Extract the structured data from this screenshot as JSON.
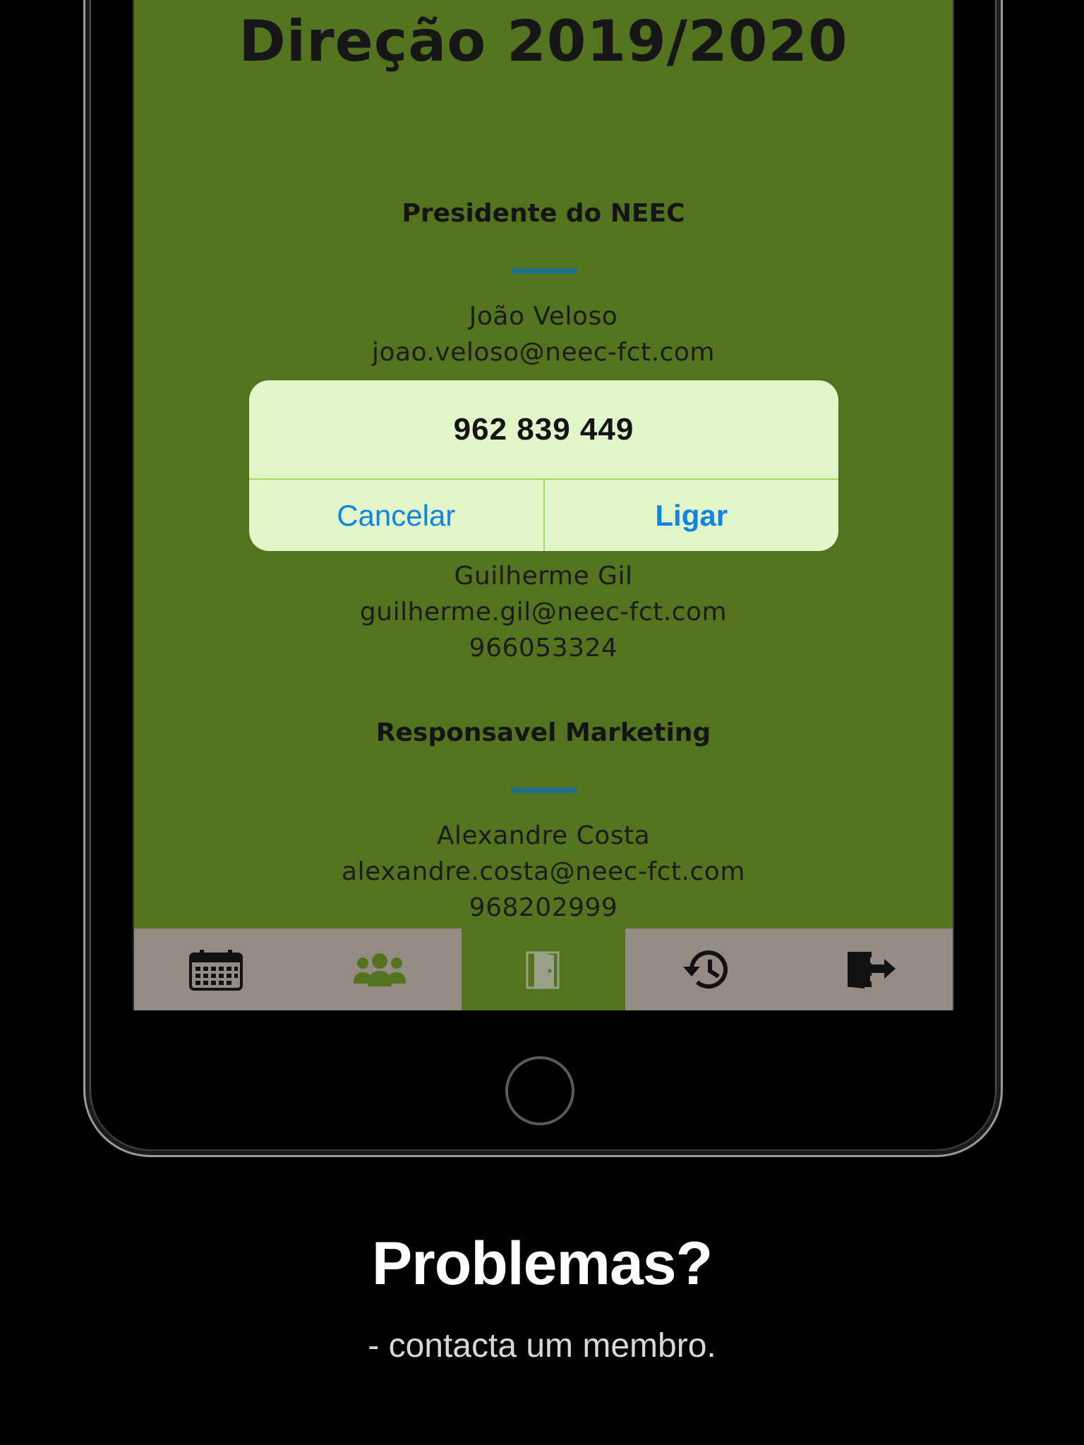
{
  "screen": {
    "title": "Direção 2019/2020",
    "sections": [
      {
        "role": "Presidente do NEEC",
        "name": "João Veloso",
        "email": "joao.veloso@neec-fct.com"
      },
      {
        "name": "Guilherme Gil",
        "email": "guilherme.gil@neec-fct.com",
        "phone": "966053324"
      },
      {
        "role": "Responsavel Marketing",
        "name": "Alexandre Costa",
        "email": "alexandre.costa@neec-fct.com",
        "phone": "968202999"
      }
    ],
    "colors": {
      "background": "#53731f",
      "divider": "#1f6e8c",
      "tabbar": "#948c84",
      "dialog": "#e1f7c9",
      "dialog_button": "#1183e3"
    }
  },
  "dialog": {
    "message": "962 839 449",
    "cancel_label": "Cancelar",
    "call_label": "Ligar"
  },
  "tabbar": {
    "tabs": [
      {
        "icon": "calendar-icon",
        "active": false
      },
      {
        "icon": "group-icon",
        "active": false
      },
      {
        "icon": "door-icon",
        "active": true
      },
      {
        "icon": "history-icon",
        "active": false
      },
      {
        "icon": "logout-icon",
        "active": false
      }
    ]
  },
  "caption": {
    "title": "Problemas?",
    "subtitle": "- contacta um membro."
  }
}
